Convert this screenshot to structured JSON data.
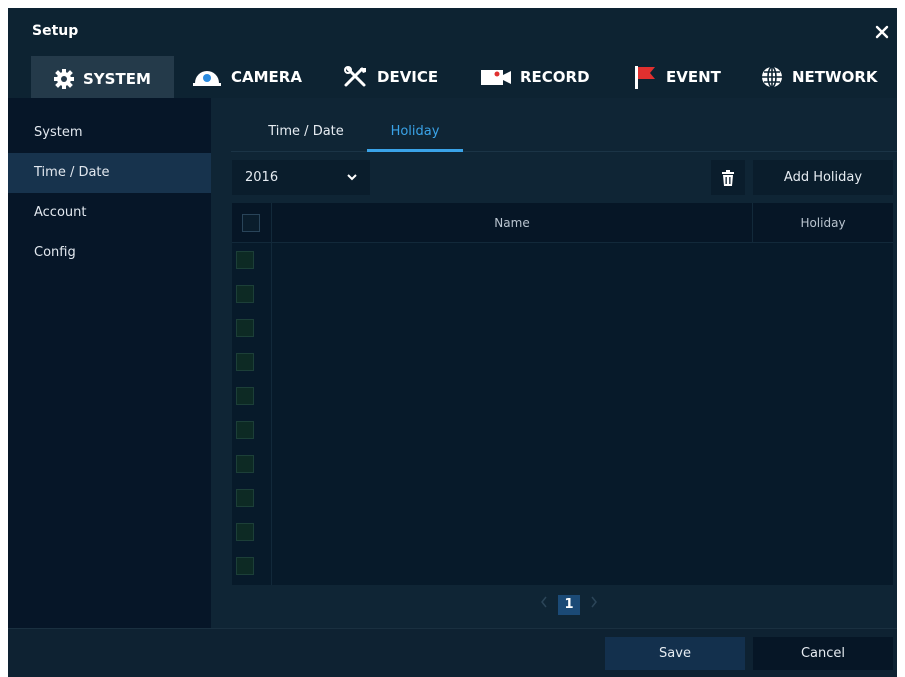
{
  "window": {
    "title": "Setup"
  },
  "topnav": {
    "tabs": [
      {
        "label": "SYSTEM",
        "icon": "gear-icon",
        "active": true
      },
      {
        "label": "CAMERA",
        "icon": "camera-dome-icon"
      },
      {
        "label": "DEVICE",
        "icon": "tools-icon"
      },
      {
        "label": "RECORD",
        "icon": "record-camera-icon"
      },
      {
        "label": "EVENT",
        "icon": "flag-icon"
      },
      {
        "label": "NETWORK",
        "icon": "globe-icon"
      }
    ]
  },
  "sidebar": {
    "items": [
      {
        "label": "System"
      },
      {
        "label": "Time / Date",
        "active": true
      },
      {
        "label": "Account"
      },
      {
        "label": "Config"
      }
    ]
  },
  "subtabs": [
    {
      "label": "Time / Date"
    },
    {
      "label": "Holiday",
      "active": true
    }
  ],
  "toolbar": {
    "year": "2016",
    "add_label": "Add Holiday"
  },
  "table": {
    "columns": [
      "Name",
      "Holiday"
    ],
    "rows": []
  },
  "pager": {
    "current": "1"
  },
  "footer": {
    "save_label": "Save",
    "cancel_label": "Cancel"
  },
  "colors": {
    "accent": "#3aa3e8",
    "background": "#0c1f2e",
    "selected": "#17334d"
  }
}
